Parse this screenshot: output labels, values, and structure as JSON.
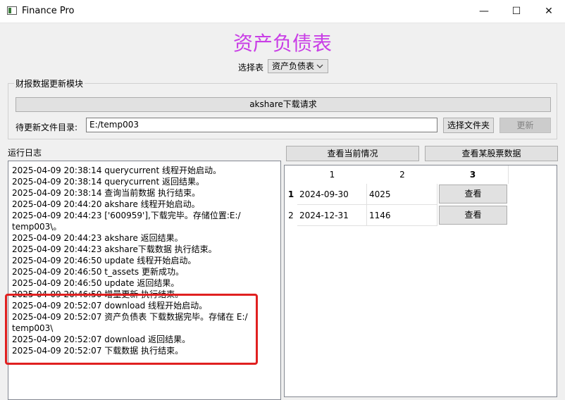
{
  "window": {
    "title": "Finance Pro",
    "minimize": "—",
    "maximize": "☐",
    "close": "✕"
  },
  "header": {
    "title": "资产负债表",
    "select_label": "选择表",
    "select_value": "资产负债表"
  },
  "update_module": {
    "group_title": "财报数据更新模块",
    "request_button": "akshare下载请求",
    "path_label": "待更新文件目录:",
    "path_value": "E:/temp003",
    "choose_folder_button": "选择文件夹",
    "update_button": "更新"
  },
  "log": {
    "label": "运行日志",
    "lines": [
      "2025-04-09 20:38:14 querycurrent 线程开始启动。",
      "2025-04-09 20:38:14 querycurrent 返回结果。",
      "2025-04-09 20:38:14 查询当前数据 执行结束。",
      "2025-04-09 20:44:20 akshare 线程开始启动。",
      "2025-04-09 20:44:23 ['600959'],下载完毕。存储位置:E:/",
      "temp003\\。",
      "2025-04-09 20:44:23 akshare 返回结果。",
      "2025-04-09 20:44:23 akshare下载数据 执行结束。",
      "2025-04-09 20:46:50 update 线程开始启动。",
      "2025-04-09 20:46:50 t_assets 更新成功。",
      "2025-04-09 20:46:50 update 返回结果。",
      "2025-04-09 20:46:50 增量更新 执行结束。",
      "2025-04-09 20:52:07 download 线程开始启动。",
      "2025-04-09 20:52:07 资产负债表 下载数据完毕。存储在 E:/",
      "temp003\\",
      "2025-04-09 20:52:07 download 返回结果。",
      "2025-04-09 20:52:07 下载数据 执行结束。"
    ]
  },
  "actions": {
    "view_current": "查看当前情况",
    "view_stock": "查看某股票数据"
  },
  "table": {
    "columns": [
      "1",
      "2",
      "3"
    ],
    "rows": [
      {
        "index": "1",
        "date": "2024-09-30",
        "value": "4025",
        "action": "查看"
      },
      {
        "index": "2",
        "date": "2024-12-31",
        "value": "1146",
        "action": "查看"
      }
    ]
  },
  "colors": {
    "title": "#c93ee6",
    "highlight": "#e02020"
  }
}
